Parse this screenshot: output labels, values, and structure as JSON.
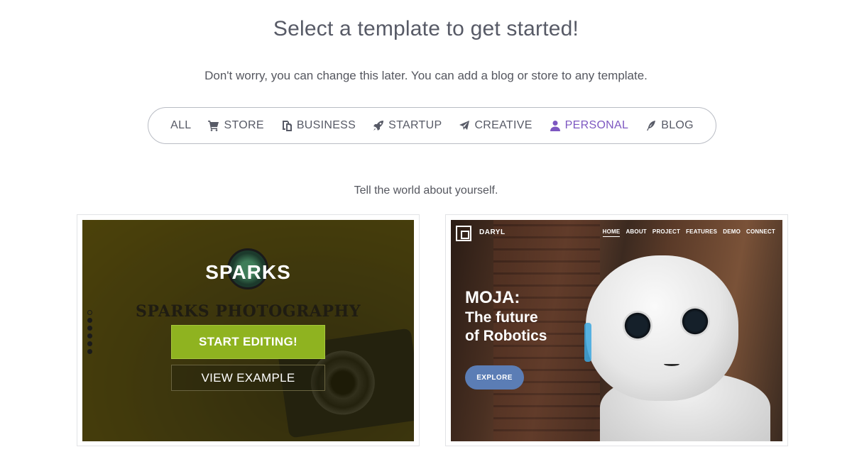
{
  "header": {
    "title": "Select a template to get started!",
    "subtitle": "Don't worry, you can change this later. You can add a blog or store to any template."
  },
  "filters": [
    {
      "label": "ALL",
      "icon": "none",
      "active": false
    },
    {
      "label": "STORE",
      "icon": "cart-icon",
      "active": false
    },
    {
      "label": "BUSINESS",
      "icon": "copy-icon",
      "active": false
    },
    {
      "label": "STARTUP",
      "icon": "rocket-icon",
      "active": false
    },
    {
      "label": "CREATIVE",
      "icon": "paper-plane-icon",
      "active": false
    },
    {
      "label": "PERSONAL",
      "icon": "user-icon",
      "active": true
    },
    {
      "label": "BLOG",
      "icon": "feather-icon",
      "active": false
    }
  ],
  "category_tagline": "Tell the world about yourself.",
  "templates": [
    {
      "logo_text": "SPARKS",
      "heading": "SPARKS PHOTOGRAPHY",
      "start_editing_label": "START EDITING!",
      "view_example_label": "VIEW EXAMPLE"
    },
    {
      "brand": "DARYL",
      "nav": [
        "HOME",
        "ABOUT",
        "PROJECT",
        "FEATURES",
        "DEMO",
        "CONNECT"
      ],
      "headline_1": "MOJA:",
      "headline_2": "The future",
      "headline_3": "of Robotics",
      "cta": "EXPLORE"
    }
  ],
  "colors": {
    "active_filter": "#7d57c1",
    "start_button": "#8fb320",
    "explore_button": "#5b7db5"
  }
}
